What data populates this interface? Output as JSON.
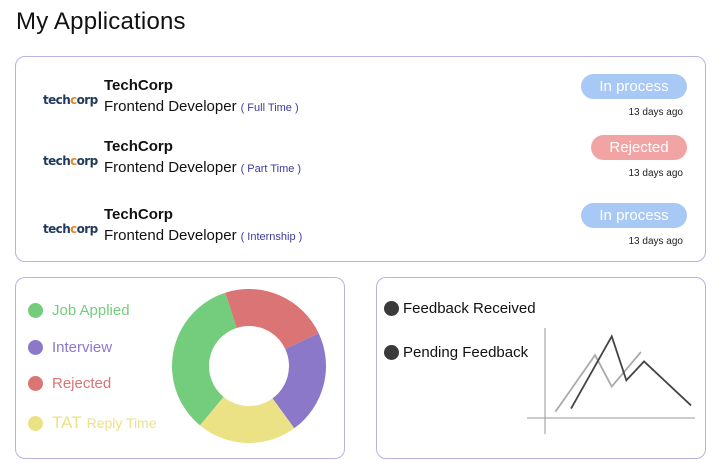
{
  "page": {
    "title": "My Applications"
  },
  "applications": [
    {
      "logo": "techcorp",
      "company": "TechCorp",
      "role": "Frontend Developer",
      "type": "( Full Time )",
      "status": "In process",
      "status_kind": "process",
      "ago": "13 days ago"
    },
    {
      "logo": "techcorp",
      "company": "TechCorp",
      "role": "Frontend Developer",
      "type": "( Part Time )",
      "status": "Rejected",
      "status_kind": "rejected",
      "ago": "13 days ago"
    },
    {
      "logo": "techcorp",
      "company": "TechCorp",
      "role": "Frontend Developer",
      "type": "( Internship )",
      "status": "In process",
      "status_kind": "process",
      "ago": "13 days ago"
    }
  ],
  "stats": {
    "legend": [
      {
        "label": "Job Applied",
        "color": "#74cc7d"
      },
      {
        "label": "Interview",
        "color": "#8b78c8"
      },
      {
        "label": "Rejected",
        "color": "#db7474"
      },
      {
        "label": "TAT",
        "label_small": "Reply Time",
        "color": "#ebe285"
      }
    ]
  },
  "feedback": {
    "legend": [
      {
        "label": "Feedback Received",
        "color": "#3a3a3a"
      },
      {
        "label": "Pending Feedback",
        "color": "#3a3a3a"
      }
    ]
  },
  "chart_data": [
    {
      "type": "pie",
      "style": "donut",
      "categories": [
        "Job Applied",
        "Interview",
        "Rejected",
        "TAT Reply Time"
      ],
      "values": [
        34,
        22,
        23,
        21
      ],
      "colors": [
        "#74cc7d",
        "#8b78c8",
        "#db7474",
        "#ebe285"
      ]
    },
    {
      "type": "line",
      "grid": false,
      "series": [
        {
          "values_x": [
            1,
            4.8,
            6.4,
            9.2
          ],
          "values_y": [
            1,
            10,
            5,
            10.5
          ],
          "color": "#aaaaaa"
        },
        {
          "values_x": [
            2.5,
            6.4,
            7.8,
            9.5,
            14
          ],
          "values_y": [
            1.5,
            13,
            6,
            9,
            2
          ],
          "color": "#444444"
        }
      ],
      "xlim": [
        0,
        14
      ],
      "ylim": [
        -2,
        14
      ]
    }
  ]
}
